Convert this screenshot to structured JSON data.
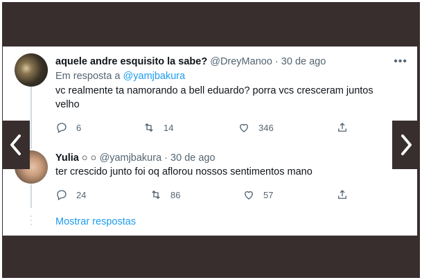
{
  "tweet1": {
    "name": "aquele andre esquisito la sabe?",
    "handle": "@DreyManoo",
    "separator": "·",
    "date": "30 de ago",
    "reply_prefix": "Em resposta a",
    "reply_mention": "@yamjbakura",
    "text_line1": "vc realmente ta namorando a bell eduardo? porra vcs cresceram juntos",
    "text_line2": "velho",
    "replies": "6",
    "retweets": "14",
    "likes": "346",
    "more_label": "•••"
  },
  "tweet2": {
    "name": "Yulia ○ ○",
    "handle": "@yamjbakura",
    "separator": "·",
    "date": "30 de ago",
    "text": "ter crescido junto foi oq aflorou nossos sentimentos mano",
    "replies": "24",
    "retweets": "86",
    "likes": "57"
  },
  "show_more": "Mostrar respostas",
  "colors": {
    "background": "#382e2e",
    "card": "#ffffff",
    "link": "#1d9bf0",
    "muted": "#536471",
    "text": "#0f1419"
  },
  "icons": [
    "reply-icon",
    "retweet-icon",
    "like-icon",
    "share-icon",
    "chevron-left-icon",
    "chevron-right-icon",
    "more-icon"
  ]
}
